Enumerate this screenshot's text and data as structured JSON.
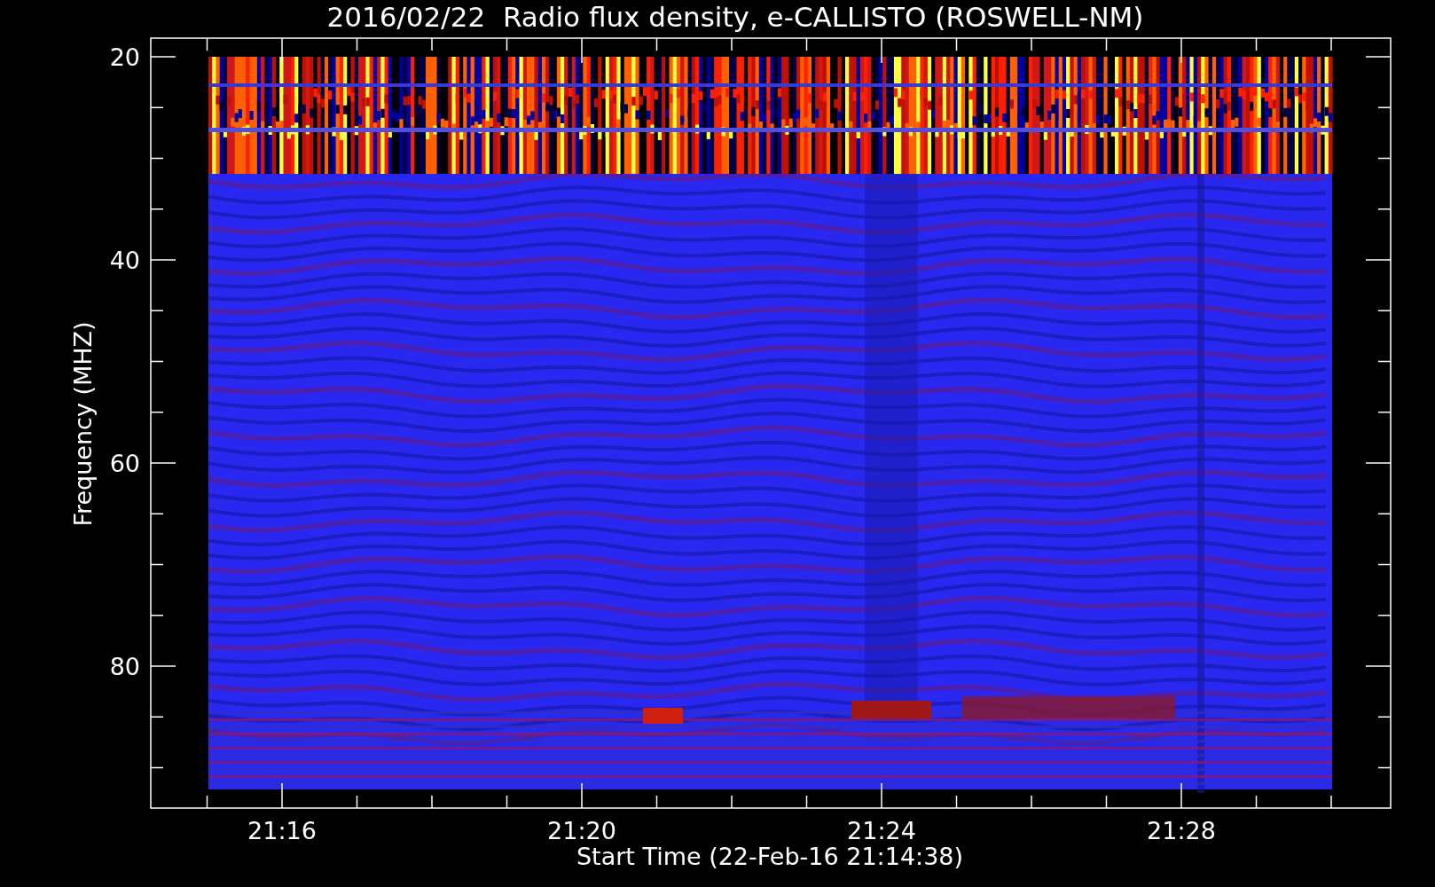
{
  "title": "2016/02/22  Radio flux density, e-CALLISTO (ROSWELL-NM)",
  "y_axis": {
    "label": "Frequency (MHZ)",
    "ticks": [
      "20",
      "40",
      "60",
      "80"
    ]
  },
  "x_axis": {
    "label": "Start Time (22-Feb-16 21:14:38)",
    "ticks": [
      "21:16",
      "21:20",
      "21:24",
      "21:28"
    ]
  }
}
